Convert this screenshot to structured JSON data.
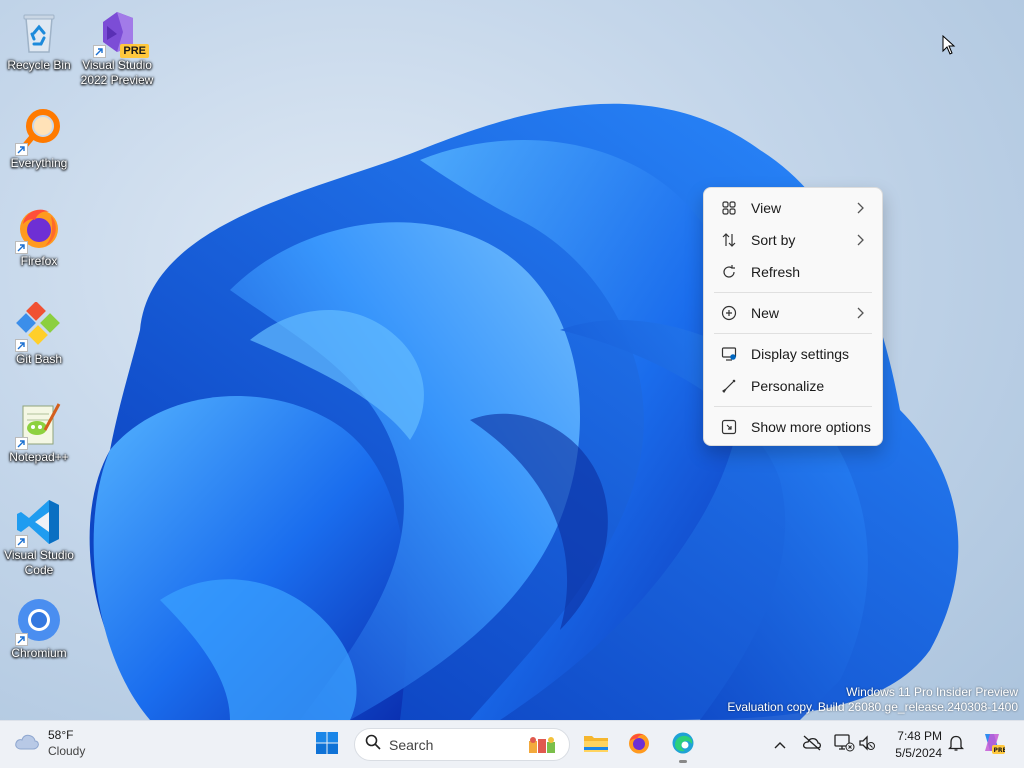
{
  "desktop": {
    "icons": [
      {
        "label": "Recycle Bin",
        "icon": "recycle-bin-icon"
      },
      {
        "label": "Visual Studio 2022 Preview",
        "label_line1": "Visual Studio",
        "label_line2": "2022 Preview",
        "badge": "PRE",
        "icon": "visual-studio-icon"
      },
      {
        "label": "Everything",
        "icon": "everything-search-icon"
      },
      {
        "label": "Firefox",
        "icon": "firefox-icon"
      },
      {
        "label": "Git Bash",
        "icon": "git-bash-icon"
      },
      {
        "label": "Notepad++",
        "icon": "notepad-plus-plus-icon"
      },
      {
        "label": "Visual Studio Code",
        "label_line1": "Visual Studio",
        "label_line2": "Code",
        "icon": "vscode-icon"
      },
      {
        "label": "Chromium",
        "icon": "chromium-icon"
      }
    ]
  },
  "context_menu": {
    "items": [
      {
        "label": "View",
        "icon": "view-grid-icon",
        "has_submenu": true
      },
      {
        "label": "Sort by",
        "icon": "sort-icon",
        "has_submenu": true
      },
      {
        "label": "Refresh",
        "icon": "refresh-icon",
        "has_submenu": false
      },
      {
        "label": "New",
        "icon": "new-plus-icon",
        "has_submenu": true
      },
      {
        "label": "Display settings",
        "icon": "display-settings-icon",
        "has_submenu": false
      },
      {
        "label": "Personalize",
        "icon": "personalize-brush-icon",
        "has_submenu": false
      },
      {
        "label": "Show more options",
        "icon": "show-more-options-icon",
        "has_submenu": false
      }
    ]
  },
  "taskbar": {
    "weather": {
      "temp": "58°F",
      "condition": "Cloudy",
      "icon": "cloud-icon"
    },
    "search": {
      "label": "Search"
    },
    "pinned": [
      {
        "name": "start",
        "icon": "windows-start-icon"
      },
      {
        "name": "file-explorer",
        "icon": "folder-icon"
      },
      {
        "name": "firefox",
        "icon": "firefox-icon"
      },
      {
        "name": "edge",
        "icon": "edge-icon",
        "active": true
      }
    ],
    "clock": {
      "time": "7:48 PM",
      "date": "5/5/2024"
    }
  },
  "watermark": {
    "line1": "Windows 11 Pro Insider Preview",
    "line2": "Evaluation copy. Build 26080.ge_release.240308-1400"
  },
  "colors": {
    "accent": "#0067c0",
    "bloom_dark": "#0a3fc8",
    "bloom_light": "#3fa3ff",
    "menu_bg": "#f9f9f9",
    "taskbar_bg": "#eef1f6"
  }
}
